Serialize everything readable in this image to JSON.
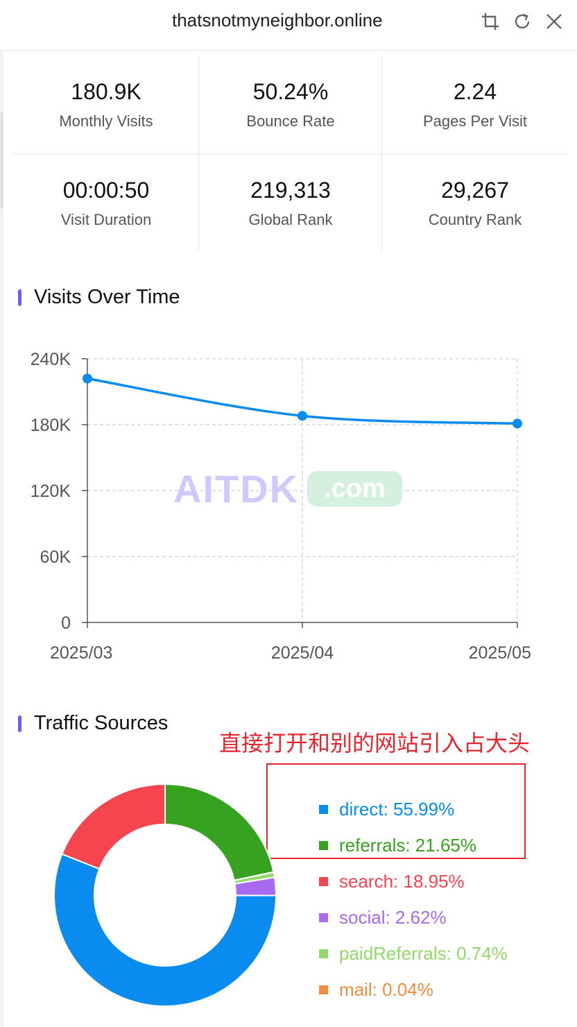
{
  "header": {
    "title": "thatsnotmyneighbor.online",
    "icons": [
      "crop-icon",
      "refresh-icon",
      "close-icon"
    ]
  },
  "stats": [
    {
      "value": "180.9K",
      "label": "Monthly Visits"
    },
    {
      "value": "50.24%",
      "label": "Bounce Rate"
    },
    {
      "value": "2.24",
      "label": "Pages Per Visit"
    },
    {
      "value": "00:00:50",
      "label": "Visit Duration"
    },
    {
      "value": "219,313",
      "label": "Global Rank"
    },
    {
      "value": "29,267",
      "label": "Country Rank"
    }
  ],
  "visits": {
    "title": "Visits Over Time"
  },
  "watermark": {
    "brand": "AITDK",
    "suffix": ".com"
  },
  "traffic": {
    "title": "Traffic Sources",
    "annotation": "直接打开和别的网站引入占大头",
    "legend": [
      {
        "label": "direct: 55.99%",
        "color": "#0a8bf0"
      },
      {
        "label": "referrals: 21.65%",
        "color": "#36a21f"
      },
      {
        "label": "search: 18.95%",
        "color": "#f5454f"
      },
      {
        "label": "social: 2.62%",
        "color": "#a86af0"
      },
      {
        "label": "paidReferrals: 0.74%",
        "color": "#93d86a"
      },
      {
        "label": "mail: 0.04%",
        "color": "#f58b3e"
      }
    ]
  },
  "colors": {
    "accent": "#6a5cff",
    "line": "#0a8bf0",
    "annotation": "#e5262c"
  },
  "chart_data": [
    {
      "type": "line",
      "title": "Visits Over Time",
      "x": [
        "2025/03",
        "2025/04",
        "2025/05"
      ],
      "series": [
        {
          "values": [
            222000,
            188000,
            181000
          ]
        }
      ],
      "yticks": [
        "0",
        "60K",
        "120K",
        "180K",
        "240K"
      ],
      "ylim": [
        0,
        240000
      ],
      "grid": true
    },
    {
      "type": "pie",
      "title": "Traffic Sources",
      "categories": [
        "direct",
        "referrals",
        "search",
        "social",
        "paidReferrals",
        "mail"
      ],
      "values": [
        55.99,
        21.65,
        18.95,
        2.62,
        0.74,
        0.04
      ],
      "colors": [
        "#0a8bf0",
        "#36a21f",
        "#f5454f",
        "#a86af0",
        "#93d86a",
        "#f58b3e"
      ]
    }
  ]
}
